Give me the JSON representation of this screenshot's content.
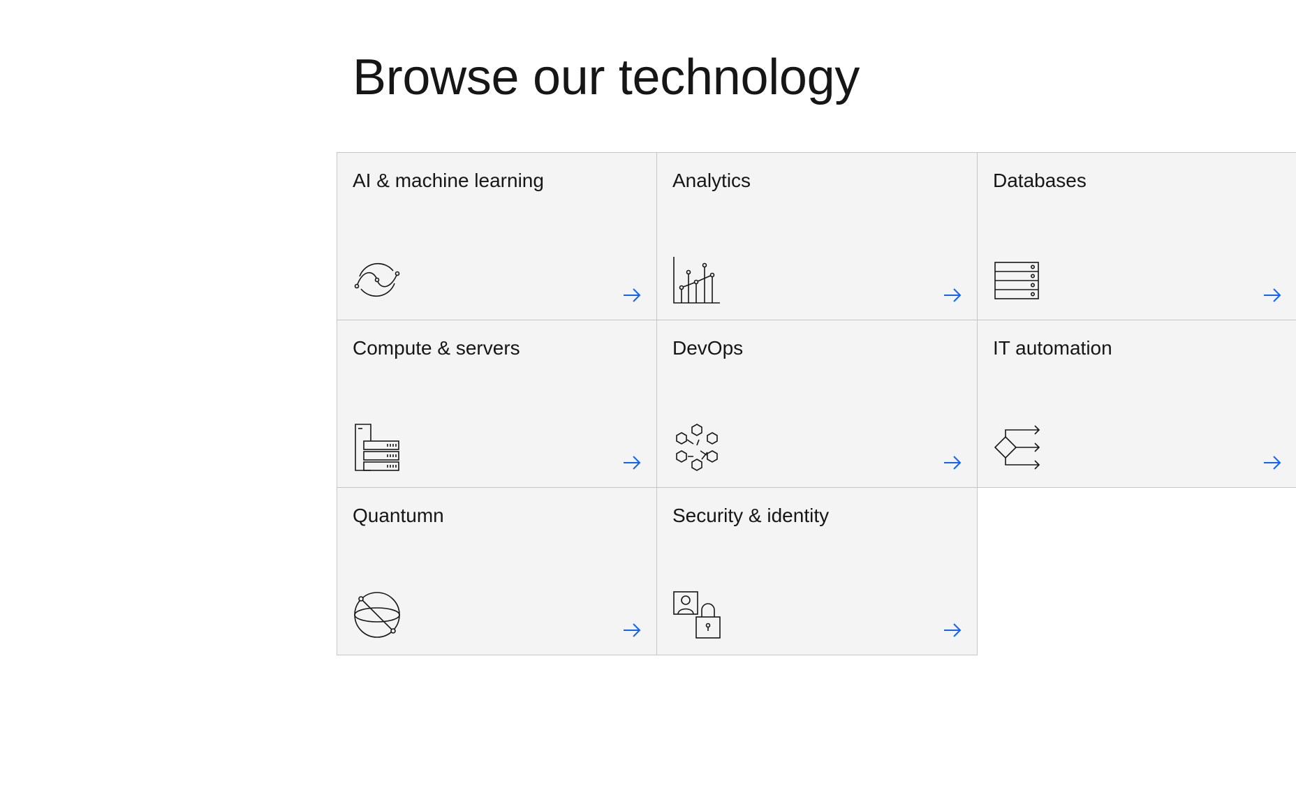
{
  "page": {
    "title": "Browse our technology"
  },
  "colors": {
    "tile_background": "#f4f4f4",
    "tile_border": "#c6c6c6",
    "arrow": "#0f62fe",
    "text": "#161616"
  },
  "tiles": [
    {
      "label": "AI & machine learning",
      "icon": "ai-machine-learning-icon"
    },
    {
      "label": "Analytics",
      "icon": "analytics-chart-icon"
    },
    {
      "label": "Databases",
      "icon": "database-server-icon"
    },
    {
      "label": "Compute & servers",
      "icon": "compute-servers-icon"
    },
    {
      "label": "DevOps",
      "icon": "devops-hexagons-icon"
    },
    {
      "label": "IT automation",
      "icon": "it-automation-flow-icon"
    },
    {
      "label": "Quantumn",
      "icon": "quantum-sphere-icon"
    },
    {
      "label": "Security & identity",
      "icon": "security-lock-identity-icon"
    }
  ]
}
